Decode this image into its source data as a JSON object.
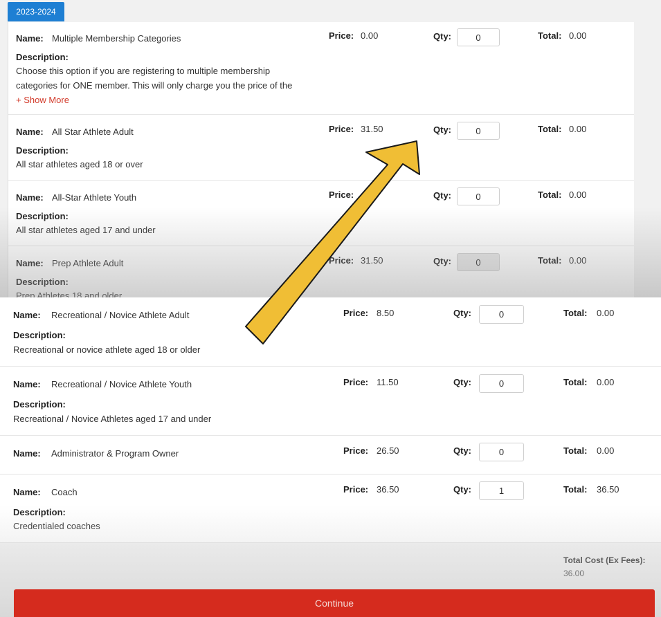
{
  "season_tab": "2023-2024",
  "labels": {
    "name": "Name:",
    "description": "Description:",
    "price": "Price:",
    "qty": "Qty:",
    "total": "Total:"
  },
  "top_items": [
    {
      "name": "Multiple Membership Categories",
      "price": "0.00",
      "qty": "0",
      "total": "0.00",
      "description_lines": [
        "Choose this option if you are registering to multiple membership",
        "categories for ONE member. This will only charge you the price of the"
      ],
      "show_more": "+ Show More"
    },
    {
      "name": "All Star Athlete Adult",
      "price": "31.50",
      "qty": "0",
      "total": "0.00",
      "description_lines": [
        "All star athletes aged 18 or over"
      ]
    },
    {
      "name": "All-Star Athlete Youth",
      "price": "",
      "qty": "0",
      "total": "0.00",
      "description_lines": [
        "All star athletes aged 17 and under"
      ]
    },
    {
      "name": "Prep Athlete Adult",
      "price": "31.50",
      "qty": "0",
      "total": "0.00",
      "description_lines": [
        "Prep Athletes 18 and older"
      ]
    }
  ],
  "bottom_items": [
    {
      "name": "Recreational / Novice Athlete Adult",
      "price": "8.50",
      "qty": "0",
      "total": "0.00",
      "description_lines": [
        "Recreational or novice athlete aged 18 or older"
      ]
    },
    {
      "name": "Recreational / Novice Athlete Youth",
      "price": "11.50",
      "qty": "0",
      "total": "0.00",
      "description_lines": [
        "Recreational / Novice Athletes aged 17 and under"
      ]
    },
    {
      "name": "Administrator & Program Owner",
      "price": "26.50",
      "qty": "0",
      "total": "0.00",
      "description_lines": []
    },
    {
      "name": "Coach",
      "price": "36.50",
      "qty": "1",
      "total": "36.50",
      "description_lines": [
        "Credentialed coaches"
      ]
    }
  ],
  "summary": {
    "total_cost_label": "Total Cost (Ex Fees):",
    "total_cost_value": "36.00"
  },
  "continue_label": "Continue",
  "colors": {
    "tab_blue": "#1e7fd3",
    "continue_red": "#d52b1e",
    "arrow_yellow": "#f0be35",
    "show_more_red": "#d23a2a"
  }
}
